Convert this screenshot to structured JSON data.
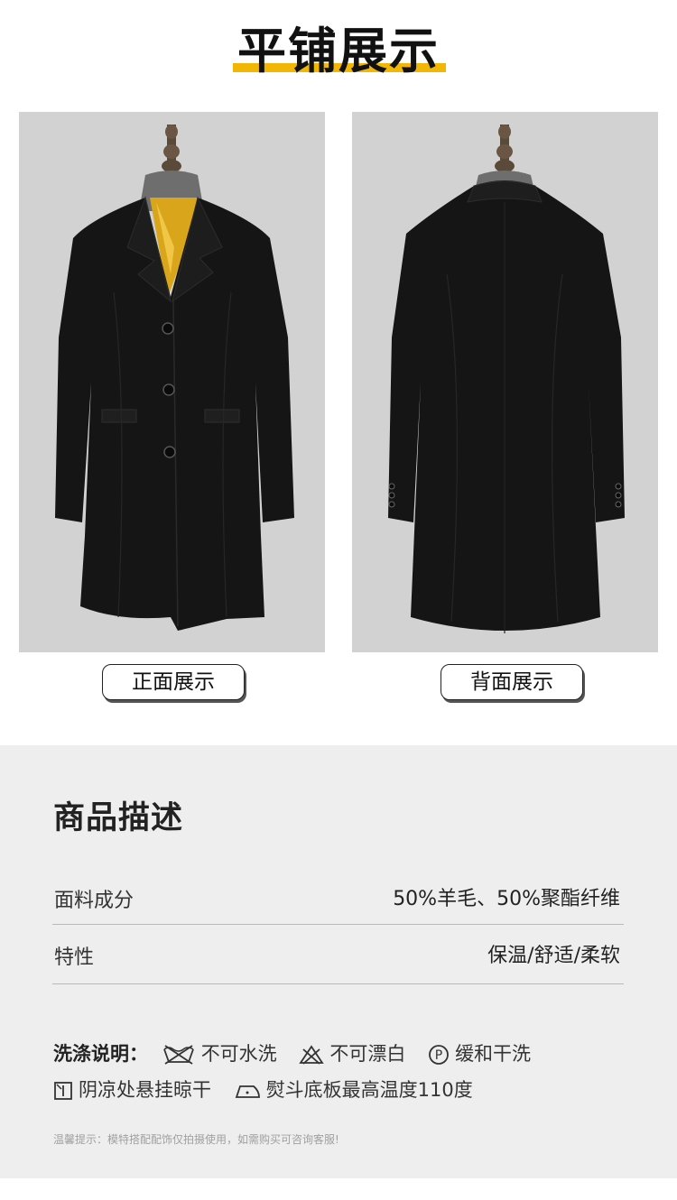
{
  "header": {
    "title": "平铺展示"
  },
  "photos": {
    "front_label": "正面展示",
    "back_label": "背面展示"
  },
  "description": {
    "title": "商品描述",
    "rows": [
      {
        "key": "面料成分",
        "value": "50%羊毛、50%聚酯纤维"
      },
      {
        "key": "特性",
        "value": "保温/舒适/柔软"
      }
    ],
    "washing": {
      "label": "洗涤说明：",
      "items": [
        {
          "icon": "no-machine-wash-icon",
          "text": "不可水洗"
        },
        {
          "icon": "no-bleach-icon",
          "text": "不可漂白"
        },
        {
          "icon": "dry-clean-p-icon",
          "text": "缓和干洗"
        },
        {
          "icon": "line-dry-shade-icon",
          "text": "阴凉处悬挂晾干"
        },
        {
          "icon": "iron-icon",
          "text": "熨斗底板最高温度110度"
        }
      ]
    },
    "tip": "温馨提示：模特搭配配饰仅拍摄使用，如需购买可咨询客服!"
  },
  "colors": {
    "accent": "#f2b705",
    "coat": "#141414",
    "photo_bg": "#d2d2d2",
    "panel_bg": "#eeeeee"
  }
}
